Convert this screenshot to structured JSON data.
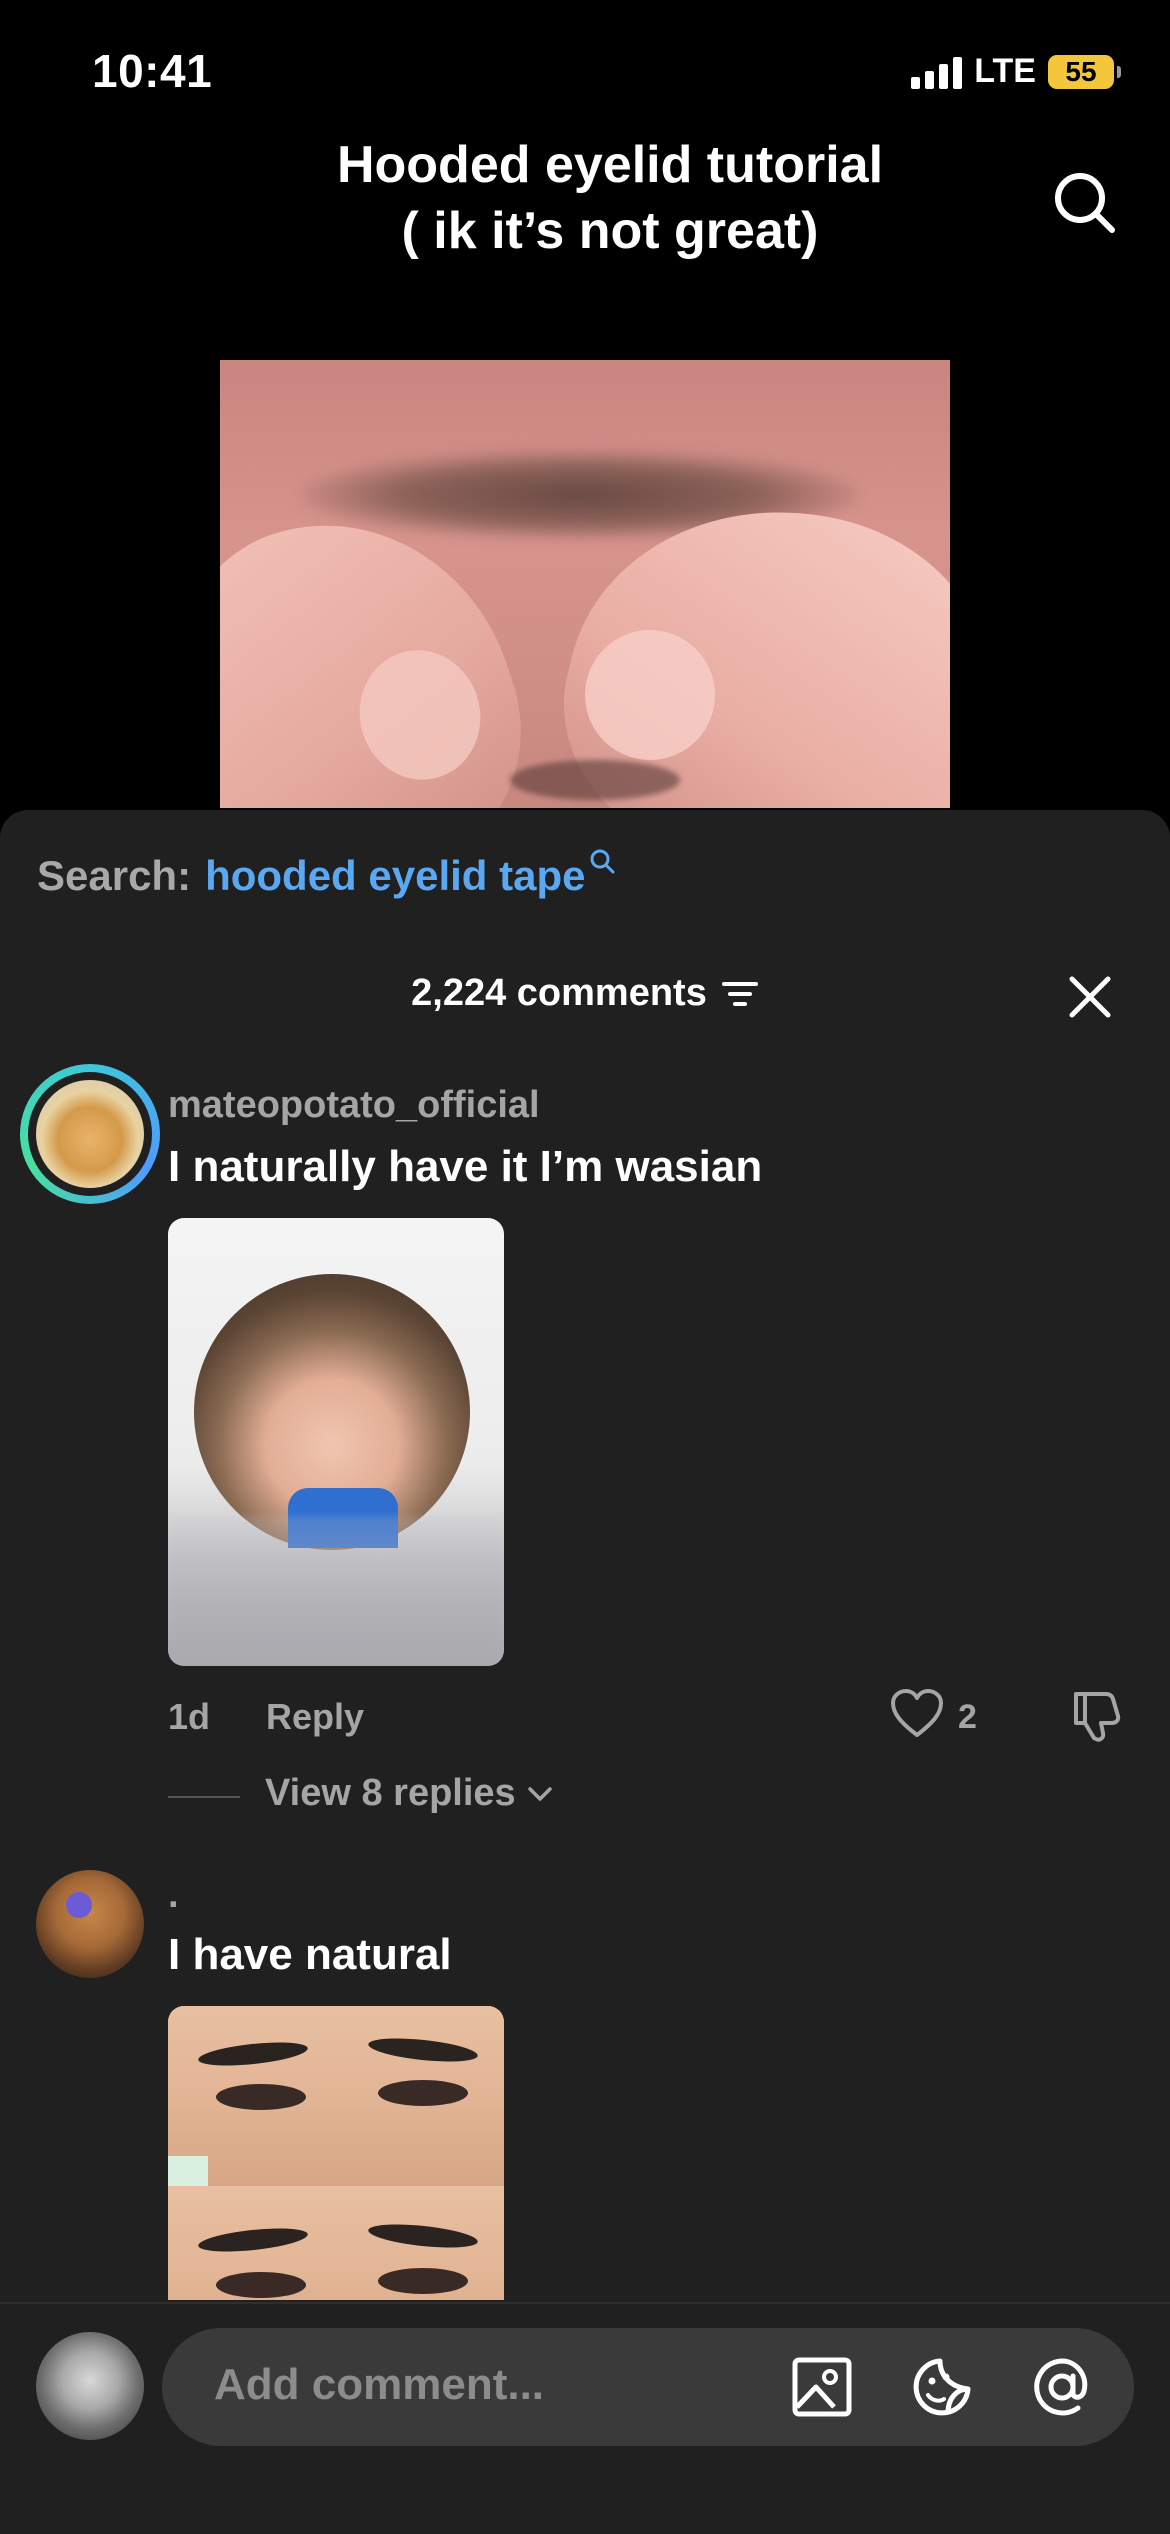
{
  "status_bar": {
    "time": "10:41",
    "network": "LTE",
    "battery": "55"
  },
  "header": {
    "title_line1": "Hooded eyelid tutorial",
    "title_line2": "( ik it’s not great)"
  },
  "search_suggestion": {
    "label": "Search:",
    "term": "hooded eyelid tape"
  },
  "comments_header": {
    "count_label": "2,224 comments"
  },
  "comments": [
    {
      "username": "mateopotato_official",
      "text": "I naturally have it I’m wasian",
      "age": "1d",
      "reply_label": "Reply",
      "likes": "2",
      "view_replies": "View 8 replies"
    },
    {
      "username": ".",
      "text": "I have natural"
    }
  ],
  "composer": {
    "placeholder": "Add comment..."
  },
  "colors": {
    "accent_blue": "#5aa7f2",
    "sheet_bg": "#202020",
    "battery": "#f3c63b"
  }
}
